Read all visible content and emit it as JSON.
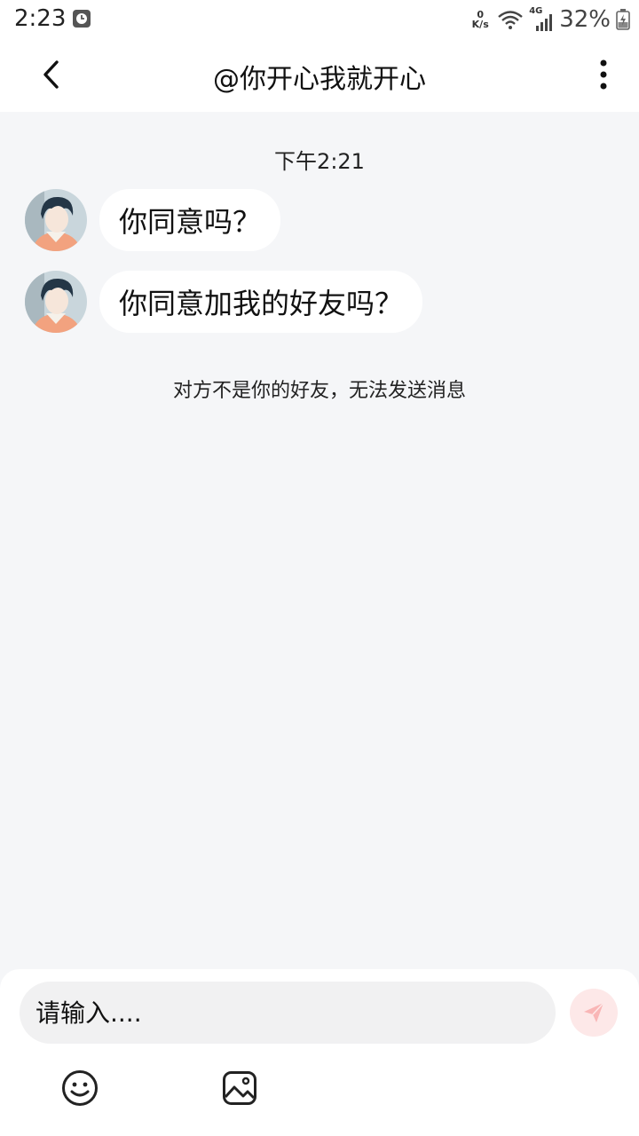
{
  "status_bar": {
    "time": "2:23",
    "net_speed_value": "0",
    "net_speed_unit": "K/s",
    "network_type": "4G",
    "battery": "32%"
  },
  "header": {
    "title": "@你开心我就开心"
  },
  "chat": {
    "timestamp": "下午2:21",
    "messages": [
      {
        "text": "你同意吗？"
      },
      {
        "text": "你同意加我的好友吗？"
      }
    ],
    "notice": "对方不是你的好友，无法发送消息"
  },
  "composer": {
    "placeholder": "请输入...."
  },
  "colors": {
    "background": "#f5f6f8",
    "bubble": "#ffffff",
    "send_button": "#fde8e8",
    "send_icon": "#f9b6b6"
  },
  "icons": {
    "back": "chevron-left-icon",
    "more": "more-vertical-icon",
    "send": "paper-plane-icon",
    "emoji": "smiley-icon",
    "image": "image-icon"
  }
}
